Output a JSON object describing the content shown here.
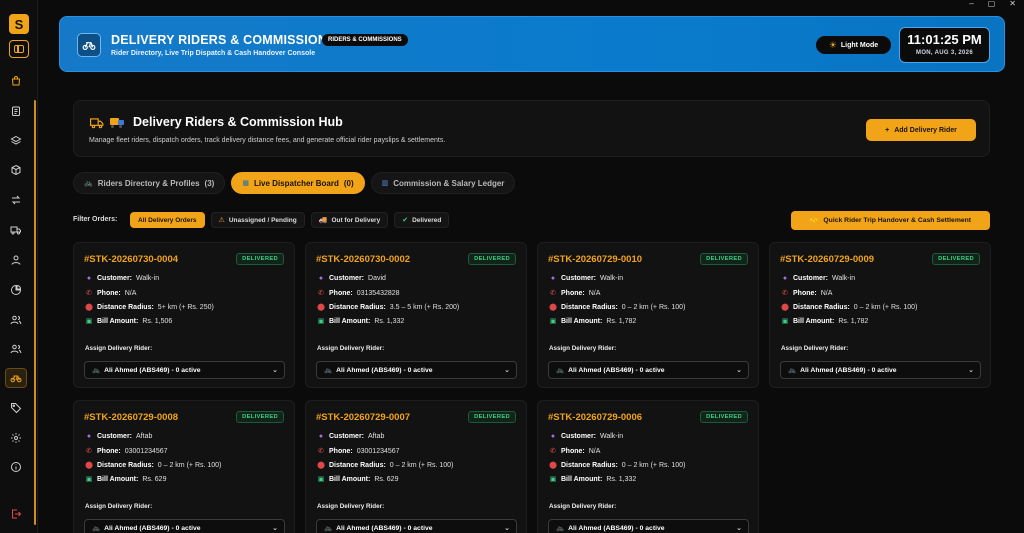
{
  "window_controls": [
    "–",
    "▢",
    "✕"
  ],
  "sidebar": {
    "logo_letter": "S",
    "items": [
      {
        "name": "sidebar-item-orders",
        "icon": "bag-icon"
      },
      {
        "name": "sidebar-item-reports",
        "icon": "clipboard-icon"
      },
      {
        "name": "sidebar-item-layers",
        "icon": "layers-icon"
      },
      {
        "name": "sidebar-item-products",
        "icon": "box-icon"
      },
      {
        "name": "sidebar-item-transfers",
        "icon": "arrows-icon"
      },
      {
        "name": "sidebar-item-delivery",
        "icon": "truck-icon"
      },
      {
        "name": "sidebar-item-customer",
        "icon": "user-icon"
      },
      {
        "name": "sidebar-item-analytics",
        "icon": "pie-icon"
      },
      {
        "name": "sidebar-item-staff",
        "icon": "users-icon"
      },
      {
        "name": "sidebar-item-team",
        "icon": "users-icon"
      },
      {
        "name": "sidebar-item-riders",
        "icon": "bike-icon",
        "active": true
      },
      {
        "name": "sidebar-item-tags",
        "icon": "tag-icon"
      },
      {
        "name": "sidebar-item-settings",
        "icon": "gear-icon"
      },
      {
        "name": "sidebar-item-info",
        "icon": "info-icon"
      },
      {
        "name": "sidebar-item-logout",
        "icon": "logout-icon"
      }
    ]
  },
  "header": {
    "title": "DELIVERY RIDERS & COMMISSION",
    "badge": "RIDERS & COMMISSIONS",
    "subtitle": "Rider Directory, Live Trip Dispatch & Cash Handover Console",
    "light_mode_label": "Light Mode",
    "time": "11:01:25 PM",
    "date": "MON, AUG 3, 2026"
  },
  "hub": {
    "title": "Delivery Riders & Commission Hub",
    "subtitle": "Manage fleet riders, dispatch orders, track delivery distance fees, and generate official rider payslips & settlements.",
    "add_button": "Add Delivery Rider",
    "add_icon": "+"
  },
  "tabs": [
    {
      "label": "Riders Directory & Profiles",
      "count": "(3)",
      "icon": "bike-icon",
      "glyph": "🚲"
    },
    {
      "label": "Live Dispatcher Board",
      "count": "(0)",
      "icon": "board-icon",
      "glyph": "▦",
      "active": true
    },
    {
      "label": "Commission & Salary Ledger",
      "count": "",
      "icon": "chart-icon",
      "glyph": "▥"
    }
  ],
  "filters": {
    "label": "Filter Orders:",
    "chips": [
      {
        "label": "All Delivery Orders",
        "glyph": "",
        "active": true
      },
      {
        "label": "Unassigned / Pending",
        "glyph": "⚠"
      },
      {
        "label": "Out for Delivery",
        "glyph": "🚚"
      },
      {
        "label": "Delivered",
        "glyph": "✔"
      }
    ],
    "handover_button": "Quick Rider Trip Handover & Cash Settlement",
    "handover_glyph": "🤝"
  },
  "labels": {
    "customer": "Customer:",
    "phone": "Phone:",
    "distance": "Distance Radius:",
    "bill": "Bill Amount:",
    "assign": "Assign Delivery Rider:"
  },
  "orders": [
    {
      "id": "#STK-20260730-0004",
      "status": "DELIVERED",
      "customer": "Walk-in",
      "phone": "N/A",
      "distance": "5+ km (+ Rs. 250)",
      "bill": "Rs. 1,506",
      "rider": "Ali Ahmed (ABS469) - 0 active"
    },
    {
      "id": "#STK-20260730-0002",
      "status": "DELIVERED",
      "customer": "David",
      "phone": "03135432828",
      "distance": "3.5 – 5 km (+ Rs. 200)",
      "bill": "Rs. 1,332",
      "rider": "Ali Ahmed (ABS469) - 0 active"
    },
    {
      "id": "#STK-20260729-0010",
      "status": "DELIVERED",
      "customer": "Walk-in",
      "phone": "N/A",
      "distance": "0 – 2 km (+ Rs. 100)",
      "bill": "Rs. 1,782",
      "rider": "Ali Ahmed (ABS469) - 0 active"
    },
    {
      "id": "#STK-20260729-0009",
      "status": "DELIVERED",
      "customer": "Walk-in",
      "phone": "N/A",
      "distance": "0 – 2 km (+ Rs. 100)",
      "bill": "Rs. 1,782",
      "rider": "Ali Ahmed (ABS469) - 0 active"
    },
    {
      "id": "#STK-20260729-0008",
      "status": "DELIVERED",
      "customer": "Aftab",
      "phone": "03001234567",
      "distance": "0 – 2 km (+ Rs. 100)",
      "bill": "Rs. 629",
      "rider": "Ali Ahmed (ABS469) - 0 active"
    },
    {
      "id": "#STK-20260729-0007",
      "status": "DELIVERED",
      "customer": "Aftab",
      "phone": "03001234567",
      "distance": "0 – 2 km (+ Rs. 100)",
      "bill": "Rs. 629",
      "rider": "Ali Ahmed (ABS469) - 0 active"
    },
    {
      "id": "#STK-20260729-0006",
      "status": "DELIVERED",
      "customer": "Walk-in",
      "phone": "N/A",
      "distance": "0 – 2 km (+ Rs. 100)",
      "bill": "Rs. 1,332",
      "rider": "Ali Ahmed (ABS469) - 0 active"
    }
  ]
}
